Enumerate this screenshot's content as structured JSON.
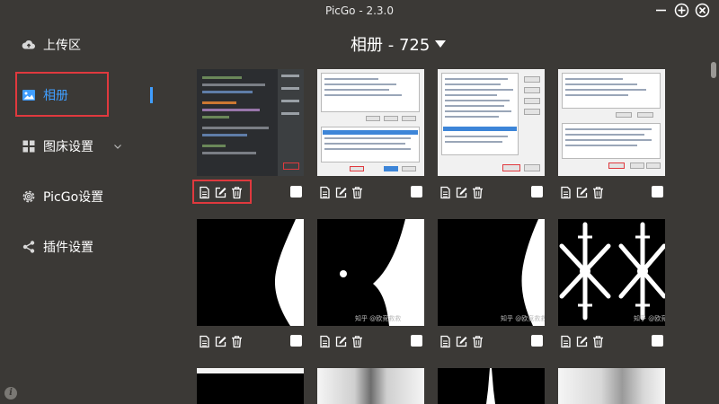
{
  "window": {
    "title": "PicGo - 2.3.0",
    "controls": [
      "minimize-icon",
      "maximize-icon",
      "close-icon"
    ]
  },
  "sidebar": {
    "items": [
      {
        "label": "上传区",
        "icon": "cloud-upload-icon",
        "active": false
      },
      {
        "label": "相册",
        "icon": "image-icon",
        "active": true
      },
      {
        "label": "图床设置",
        "icon": "grid-icon",
        "active": false,
        "expandable": true
      },
      {
        "label": "PicGo设置",
        "icon": "gear-icon",
        "active": false
      },
      {
        "label": "插件设置",
        "icon": "share-icon",
        "active": false
      }
    ],
    "info_icon": "i"
  },
  "gallery": {
    "title": "相册 - 725",
    "dropdown_icon": "caret-down-icon",
    "item_actions": [
      "copy-link-icon",
      "edit-icon",
      "delete-icon"
    ],
    "images": [
      {
        "kind": "code-editor-screenshot",
        "checked": false,
        "highlighted_actions": true
      },
      {
        "kind": "dialog-screenshot",
        "checked": false
      },
      {
        "kind": "dialog-screenshot-list",
        "checked": false
      },
      {
        "kind": "dialog-screenshot",
        "checked": false
      },
      {
        "kind": "black-white-curve",
        "checked": false
      },
      {
        "kind": "black-white-curve-dot",
        "checked": false,
        "watermark": "知乎 @欧竞救救"
      },
      {
        "kind": "black-white-curve-right",
        "checked": false,
        "watermark": "知乎 @欧竞救救"
      },
      {
        "kind": "snowflake-pattern",
        "checked": false,
        "watermark": "知乎 @欧竞救救"
      },
      {
        "kind": "partial-dark",
        "checked": false
      },
      {
        "kind": "partial-gradient",
        "checked": false
      },
      {
        "kind": "partial-dark-spike",
        "checked": false
      },
      {
        "kind": "partial-gradient",
        "checked": false
      }
    ]
  },
  "colors": {
    "background": "#3b3936",
    "accent": "#409eff",
    "highlight_border": "#e0393e"
  }
}
